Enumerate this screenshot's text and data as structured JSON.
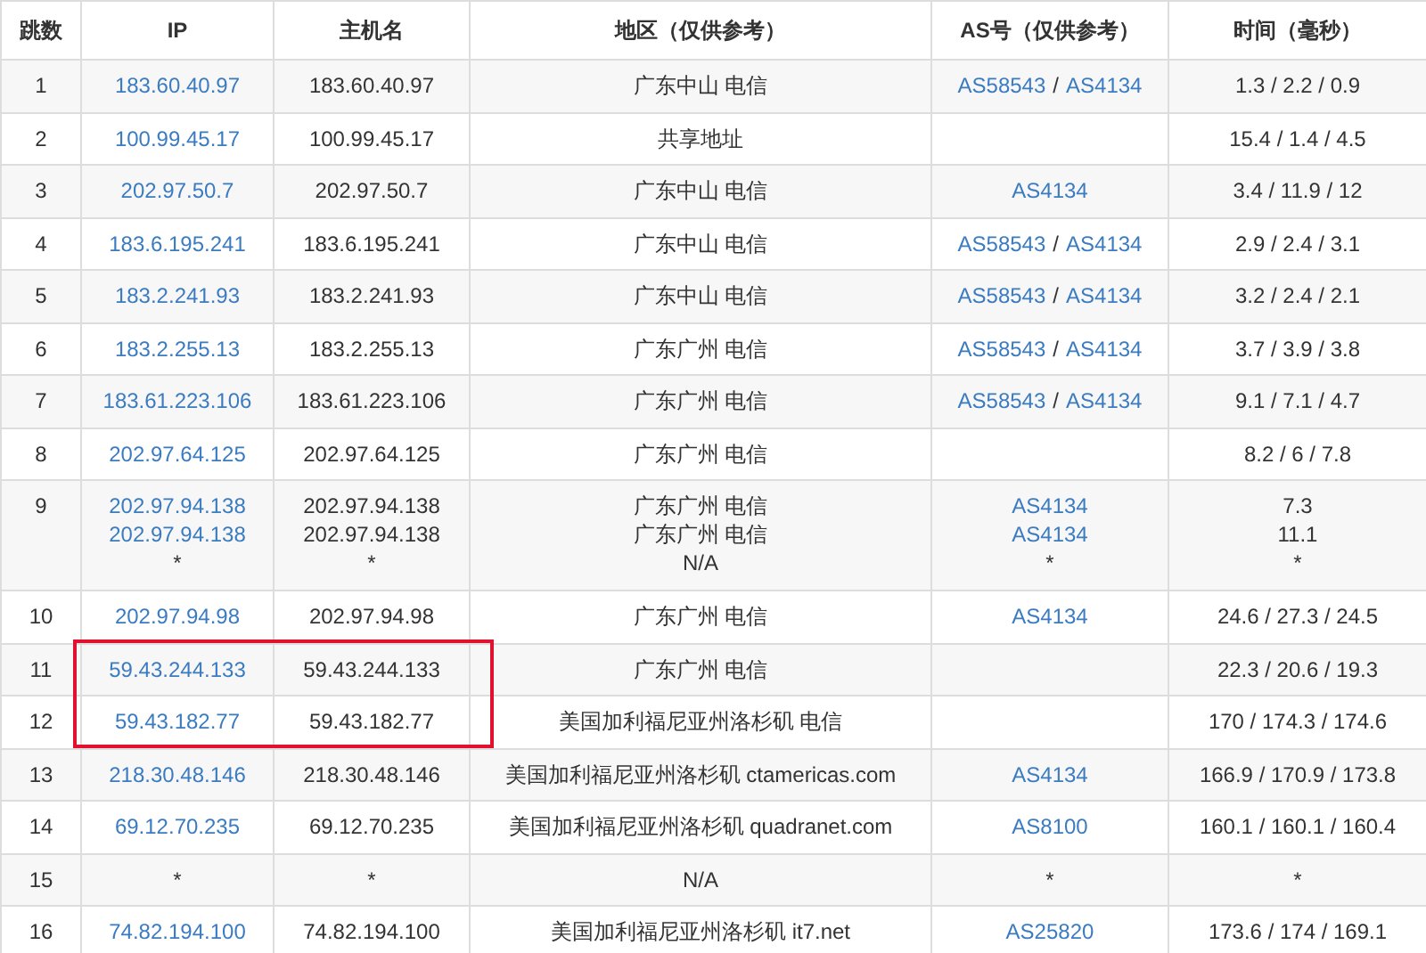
{
  "table": {
    "columns": [
      "跳数",
      "IP",
      "主机名",
      "地区（仅供参考）",
      "AS号（仅供参考）",
      "时间（毫秒）"
    ],
    "rows": [
      {
        "hop": "1",
        "ip": [
          [
            {
              "text": "183.60.40.97",
              "link": true
            }
          ]
        ],
        "host": [
          "183.60.40.97"
        ],
        "region": [
          "广东中山 电信"
        ],
        "as": [
          [
            {
              "text": "AS58543",
              "link": true
            },
            {
              "text": "/",
              "link": false
            },
            {
              "text": "AS4134",
              "link": true
            }
          ]
        ],
        "time": [
          "1.3 / 2.2 / 0.9"
        ],
        "marked": false
      },
      {
        "hop": "2",
        "ip": [
          [
            {
              "text": "100.99.45.17",
              "link": true
            }
          ]
        ],
        "host": [
          "100.99.45.17"
        ],
        "region": [
          "共享地址"
        ],
        "time": [
          "15.4 / 1.4 / 4.5"
        ],
        "marked": false
      },
      {
        "hop": "3",
        "ip": [
          [
            {
              "text": "202.97.50.7",
              "link": true
            }
          ]
        ],
        "host": [
          "202.97.50.7"
        ],
        "region": [
          "广东中山 电信"
        ],
        "as": [
          [
            {
              "text": "AS4134",
              "link": true
            }
          ]
        ],
        "time": [
          "3.4 / 11.9 / 12"
        ],
        "marked": false
      },
      {
        "hop": "4",
        "ip": [
          [
            {
              "text": "183.6.195.241",
              "link": true
            }
          ]
        ],
        "host": [
          "183.6.195.241"
        ],
        "region": [
          "广东中山 电信"
        ],
        "as": [
          [
            {
              "text": "AS58543",
              "link": true
            },
            {
              "text": "/",
              "link": false
            },
            {
              "text": "AS4134",
              "link": true
            }
          ]
        ],
        "time": [
          "2.9 / 2.4 / 3.1"
        ],
        "marked": false
      },
      {
        "hop": "5",
        "ip": [
          [
            {
              "text": "183.2.241.93",
              "link": true
            }
          ]
        ],
        "host": [
          "183.2.241.93"
        ],
        "region": [
          "广东中山 电信"
        ],
        "as": [
          [
            {
              "text": "AS58543",
              "link": true
            },
            {
              "text": "/",
              "link": false
            },
            {
              "text": "AS4134",
              "link": true
            }
          ]
        ],
        "time": [
          "3.2 / 2.4 / 2.1"
        ],
        "marked": false
      },
      {
        "hop": "6",
        "ip": [
          [
            {
              "text": "183.2.255.13",
              "link": true
            }
          ]
        ],
        "host": [
          "183.2.255.13"
        ],
        "region": [
          "广东广州 电信"
        ],
        "as": [
          [
            {
              "text": "AS58543",
              "link": true
            },
            {
              "text": "/",
              "link": false
            },
            {
              "text": "AS4134",
              "link": true
            }
          ]
        ],
        "time": [
          "3.7 / 3.9 / 3.8"
        ],
        "marked": false
      },
      {
        "hop": "7",
        "ip": [
          [
            {
              "text": "183.61.223.106",
              "link": true
            }
          ]
        ],
        "host": [
          "183.61.223.106"
        ],
        "region": [
          "广东广州 电信"
        ],
        "as": [
          [
            {
              "text": "AS58543",
              "link": true
            },
            {
              "text": "/",
              "link": false
            },
            {
              "text": "AS4134",
              "link": true
            }
          ]
        ],
        "time": [
          "9.1 / 7.1 / 4.7"
        ],
        "marked": false
      },
      {
        "hop": "8",
        "ip": [
          [
            {
              "text": "202.97.64.125",
              "link": true
            }
          ]
        ],
        "host": [
          "202.97.64.125"
        ],
        "region": [
          "广东广州 电信"
        ],
        "time": [
          "8.2 / 6 / 7.8"
        ],
        "marked": false
      },
      {
        "hop": "9",
        "ip": [
          [
            {
              "text": "202.97.94.138",
              "link": true
            }
          ],
          [
            {
              "text": "202.97.94.138",
              "link": true
            }
          ],
          [
            {
              "text": "*",
              "link": false
            }
          ]
        ],
        "host": [
          "202.97.94.138",
          "202.97.94.138",
          "*"
        ],
        "region": [
          "广东广州 电信",
          "广东广州 电信",
          "N/A"
        ],
        "as": [
          [
            {
              "text": "AS4134",
              "link": true
            }
          ],
          [
            {
              "text": "AS4134",
              "link": true
            }
          ],
          [
            {
              "text": "*",
              "link": false
            }
          ]
        ],
        "time": [
          "7.3",
          "11.1",
          "*"
        ],
        "marked": false
      },
      {
        "hop": "10",
        "ip": [
          [
            {
              "text": "202.97.94.98",
              "link": true
            }
          ]
        ],
        "host": [
          "202.97.94.98"
        ],
        "region": [
          "广东广州 电信"
        ],
        "as": [
          [
            {
              "text": "AS4134",
              "link": true
            }
          ]
        ],
        "time": [
          "24.6 / 27.3 / 24.5"
        ],
        "marked": false
      },
      {
        "hop": "11",
        "ip": [
          [
            {
              "text": "59.43.244.133",
              "link": true
            }
          ]
        ],
        "host": [
          "59.43.244.133"
        ],
        "region": [
          "广东广州 电信"
        ],
        "time": [
          "22.3 / 20.6 / 19.3"
        ],
        "marked": true
      },
      {
        "hop": "12",
        "ip": [
          [
            {
              "text": "59.43.182.77",
              "link": true
            }
          ]
        ],
        "host": [
          "59.43.182.77"
        ],
        "region": [
          "美国加利福尼亚州洛杉矶 电信"
        ],
        "time": [
          "170 / 174.3 / 174.6"
        ],
        "marked": true
      },
      {
        "hop": "13",
        "ip": [
          [
            {
              "text": "218.30.48.146",
              "link": true
            }
          ]
        ],
        "host": [
          "218.30.48.146"
        ],
        "region": [
          "美国加利福尼亚州洛杉矶 ctamericas.com"
        ],
        "as": [
          [
            {
              "text": "AS4134",
              "link": true
            }
          ]
        ],
        "time": [
          "166.9 / 170.9 / 173.8"
        ],
        "marked": false
      },
      {
        "hop": "14",
        "ip": [
          [
            {
              "text": "69.12.70.235",
              "link": true
            }
          ]
        ],
        "host": [
          "69.12.70.235"
        ],
        "region": [
          "美国加利福尼亚州洛杉矶 quadranet.com"
        ],
        "as": [
          [
            {
              "text": "AS8100",
              "link": true
            }
          ]
        ],
        "time": [
          "160.1 / 160.1 / 160.4"
        ],
        "marked": false
      },
      {
        "hop": "15",
        "ip": [
          [
            {
              "text": "*",
              "link": false
            }
          ]
        ],
        "host": [
          "*"
        ],
        "region": [
          "N/A"
        ],
        "as": [
          [
            {
              "text": "*",
              "link": false
            }
          ]
        ],
        "time": [
          "*"
        ],
        "marked": false
      },
      {
        "hop": "16",
        "ip": [
          [
            {
              "text": "74.82.194.100",
              "link": true
            }
          ]
        ],
        "host": [
          "74.82.194.100"
        ],
        "region": [
          "美国加利福尼亚州洛杉矶 it7.net"
        ],
        "as": [
          [
            {
              "text": "AS25820",
              "link": true
            }
          ]
        ],
        "time": [
          "173.6 / 174 / 169.1"
        ],
        "marked": false
      }
    ]
  }
}
